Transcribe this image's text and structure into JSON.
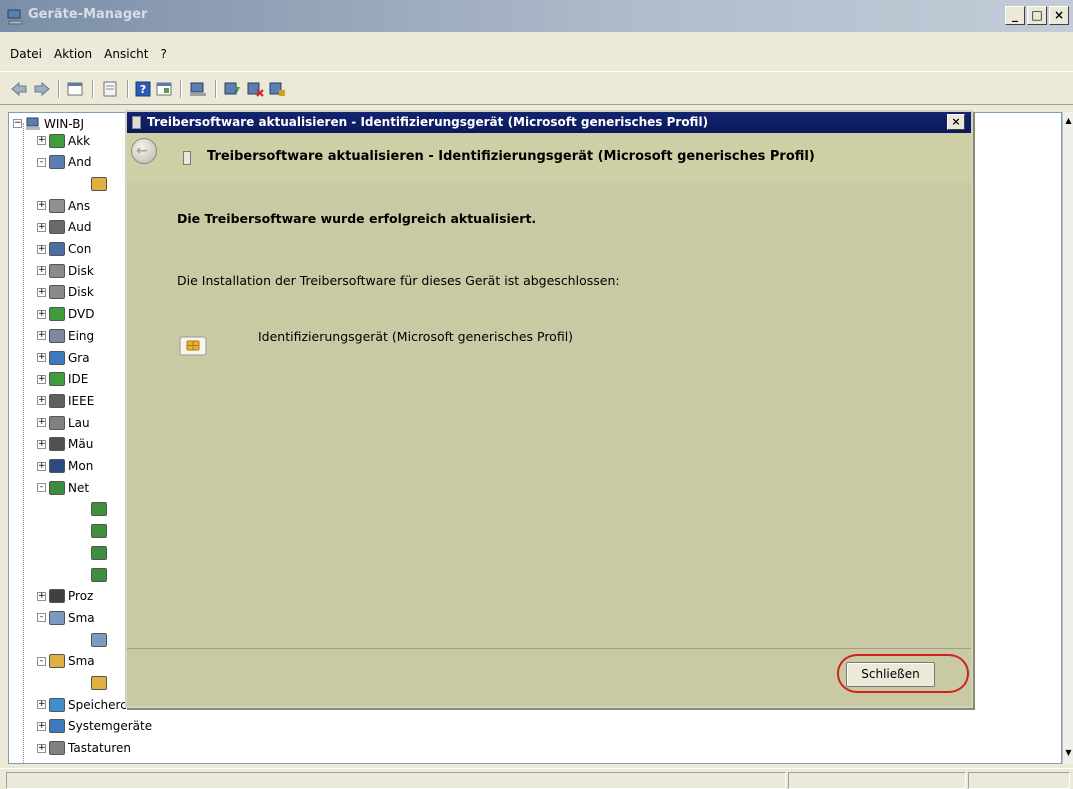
{
  "window": {
    "title": "Geräte-Manager",
    "buttons": {
      "minimize": "_",
      "maximize": "□",
      "close": "×"
    }
  },
  "menu": [
    "Datei",
    "Aktion",
    "Ansicht",
    "?"
  ],
  "toolbar": {
    "icons": [
      "back-icon",
      "forward-icon",
      "properties-view-icon",
      "properties-icon",
      "help-icon",
      "view-icon",
      "scan-hardware-icon",
      "update-driver-icon",
      "disable-device-icon",
      "uninstall-device-icon"
    ]
  },
  "tree": {
    "root": "WIN-BJ",
    "items": [
      {
        "label": "Akk",
        "state": "+"
      },
      {
        "label": "And",
        "state": "-"
      },
      {
        "label": "",
        "state": ""
      },
      {
        "label": "Ans",
        "state": "+"
      },
      {
        "label": "Aud",
        "state": "+"
      },
      {
        "label": "Con",
        "state": "+"
      },
      {
        "label": "Disk",
        "state": "+"
      },
      {
        "label": "Disk",
        "state": "+"
      },
      {
        "label": "DVD",
        "state": "+"
      },
      {
        "label": "Eing",
        "state": "+"
      },
      {
        "label": "Gra",
        "state": "+"
      },
      {
        "label": "IDE",
        "state": "+"
      },
      {
        "label": "IEEE",
        "state": "+"
      },
      {
        "label": "Lau",
        "state": "+"
      },
      {
        "label": "Mäu",
        "state": "+"
      },
      {
        "label": "Mon",
        "state": "+"
      },
      {
        "label": "Net",
        "state": "-"
      },
      {
        "label": "",
        "state": ""
      },
      {
        "label": "",
        "state": ""
      },
      {
        "label": "",
        "state": ""
      },
      {
        "label": "",
        "state": ""
      },
      {
        "label": "Proz",
        "state": "+"
      },
      {
        "label": "Sma",
        "state": "-"
      },
      {
        "label": "",
        "state": ""
      },
      {
        "label": "Sma",
        "state": "-"
      },
      {
        "label": "",
        "state": ""
      },
      {
        "label": "Speichercontroller",
        "state": "+"
      },
      {
        "label": "Systemgeräte",
        "state": "+"
      },
      {
        "label": "Tastaturen",
        "state": "+"
      }
    ]
  },
  "dialog": {
    "title": "Treibersoftware aktualisieren - Identifizierungsgerät (Microsoft generisches Profil)",
    "header_title": "Treibersoftware aktualisieren - Identifizierungsgerät (Microsoft generisches Profil)",
    "success_message": "Die Treibersoftware wurde erfolgreich aktualisiert.",
    "install_message": "Die Installation der Treibersoftware für dieses Gerät ist abgeschlossen:",
    "device_name": "Identifizierungsgerät (Microsoft generisches Profil)",
    "close_button": "Schließen",
    "close_x": "×"
  },
  "colors": {
    "dialog_bg": "#c9c9a3",
    "dialog_title_bg": "#14246e",
    "highlight": "#cc2222"
  }
}
